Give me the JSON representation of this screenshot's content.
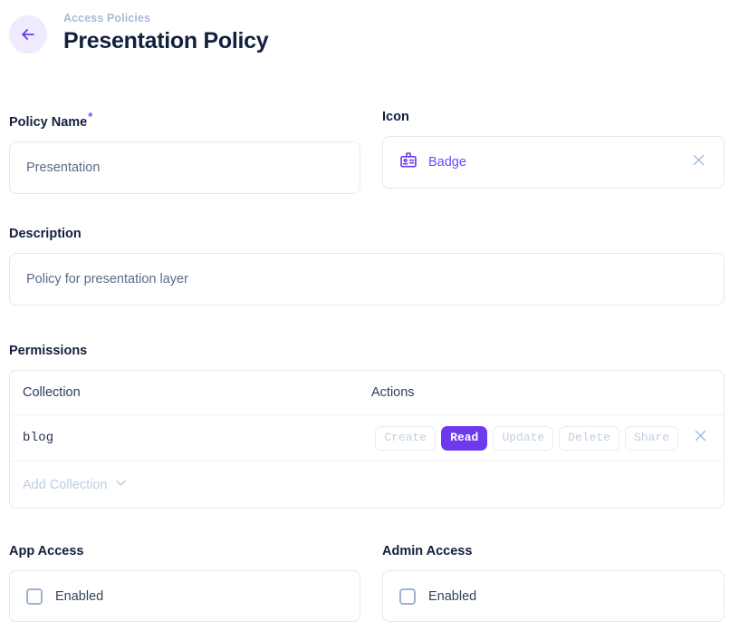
{
  "header": {
    "back_icon": "arrow-left-icon",
    "breadcrumb": "Access Policies",
    "title": "Presentation Policy"
  },
  "policy_name": {
    "label": "Policy Name",
    "required_marker": "*",
    "value": "Presentation",
    "placeholder": "Policy Name"
  },
  "icon_field": {
    "label": "Icon",
    "icon_name": "badge-icon",
    "value": "Badge",
    "clear_icon": "close-icon"
  },
  "description": {
    "label": "Description",
    "value": "Policy for presentation layer",
    "placeholder": "Description"
  },
  "permissions": {
    "label": "Permissions",
    "columns": [
      "Collection",
      "Actions"
    ],
    "rows": [
      {
        "collection": "blog",
        "actions": [
          {
            "label": "Create",
            "active": false
          },
          {
            "label": "Read",
            "active": true
          },
          {
            "label": "Update",
            "active": false
          },
          {
            "label": "Delete",
            "active": false
          },
          {
            "label": "Share",
            "active": false
          }
        ],
        "remove_icon": "close-icon"
      }
    ],
    "add_label": "Add Collection",
    "add_icon": "chevron-down-icon"
  },
  "app_access": {
    "label": "App Access",
    "checkbox_label": "Enabled",
    "checked": false
  },
  "admin_access": {
    "label": "Admin Access",
    "checkbox_label": "Enabled",
    "checked": false
  },
  "colors": {
    "accent": "#6d3aee",
    "accent_soft": "#efeafd",
    "text_dark": "#12203c",
    "text_muted": "#5a6b86",
    "border": "#e2e8f2",
    "chip_inactive_text": "#c3cfe2"
  }
}
